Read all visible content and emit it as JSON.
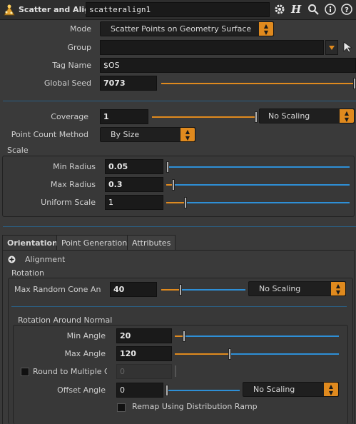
{
  "header": {
    "node_type": "Scatter and Align",
    "node_name": "scatteralign1"
  },
  "params": {
    "mode_label": "Mode",
    "mode_value": "Scatter Points on Geometry Surface",
    "group_label": "Group",
    "group_value": "",
    "tag_label": "Tag Name",
    "tag_value": "$OS",
    "seed_label": "Global Seed",
    "seed_value": "7073",
    "seed_fraction": 1.0,
    "coverage_label": "Coverage",
    "coverage_value": "1",
    "coverage_fraction": 1.0,
    "coverage_scaling": "No Scaling",
    "pcm_label": "Point Count Method",
    "pcm_value": "By Size"
  },
  "scale": {
    "title": "Scale",
    "min_label": "Min Radius",
    "min_value": "0.05",
    "min_fraction": 0.0,
    "max_label": "Max Radius",
    "max_value": "0.3",
    "max_fraction": 0.03,
    "uni_label": "Uniform Scale",
    "uni_value": "1",
    "uni_fraction": 0.1
  },
  "tabs": [
    "Orientation",
    "Point Generation",
    "Attributes"
  ],
  "orientation": {
    "alignment_label": "Alignment",
    "rotation_title": "Rotation",
    "cone_label": "Max Random Cone An...",
    "cone_value": "40",
    "cone_fraction": 0.22,
    "cone_scaling": "No Scaling",
    "ran_title": "Rotation Around Normal",
    "min_angle_label": "Min Angle",
    "min_angle_value": "20",
    "min_angle_fraction": 0.05,
    "max_angle_label": "Max Angle",
    "max_angle_value": "120",
    "max_angle_fraction": 0.33,
    "round_label": "Round to Multiple Of",
    "round_value": "0",
    "offset_label": "Offset Angle",
    "offset_value": "0",
    "offset_fraction": 0.0,
    "offset_scaling": "No Scaling",
    "remap_label": "Remap Using Distribution Ramp"
  },
  "colors": {
    "accent": "#e08a1e",
    "slider_blue": "#2e8fd6",
    "separator": "#2a5f84"
  }
}
